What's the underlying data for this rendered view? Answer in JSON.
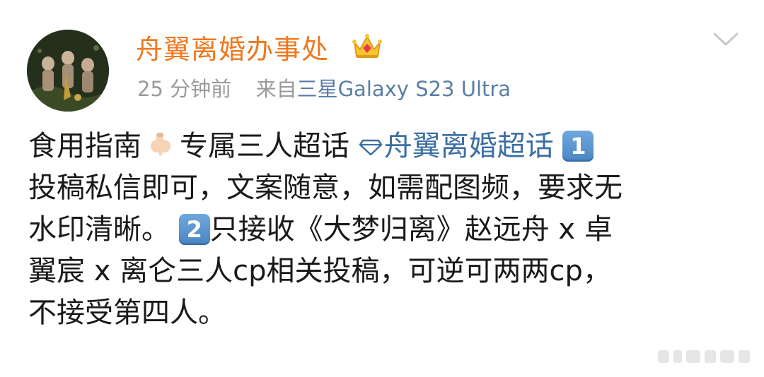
{
  "post": {
    "username": "舟翼离婚办事处",
    "time": "25 分钟前",
    "from_label": "来自",
    "source": "三星Galaxy S23 Ultra",
    "body": {
      "part1": "食用指南",
      "part2": "专属三人超话",
      "topic": "舟翼离婚超话",
      "num1": "1",
      "line2": "投稿私信即可，文案随意，如需配图频，要求无",
      "line3_a": "水印清晰。",
      "num2": "2",
      "line3_b": "只接收《大梦归离》赵远舟 x 卓",
      "line4": "翼宸 x 离仑三人cp相关投稿，可逆可两两cp，",
      "line5": "不接受第四人。"
    }
  },
  "icons": {
    "avatar": "avatar-image",
    "crown": "crown-icon",
    "chevron": "chevron-down-icon",
    "hand": "pointing-down-hand-icon",
    "gem": "diamond-topic-icon",
    "keycap": "keycap-number-icon"
  },
  "colors": {
    "username": "#f0781e",
    "meta": "#9a9a9a",
    "link": "#3d6fa3",
    "body_text": "#1a1a1a"
  }
}
